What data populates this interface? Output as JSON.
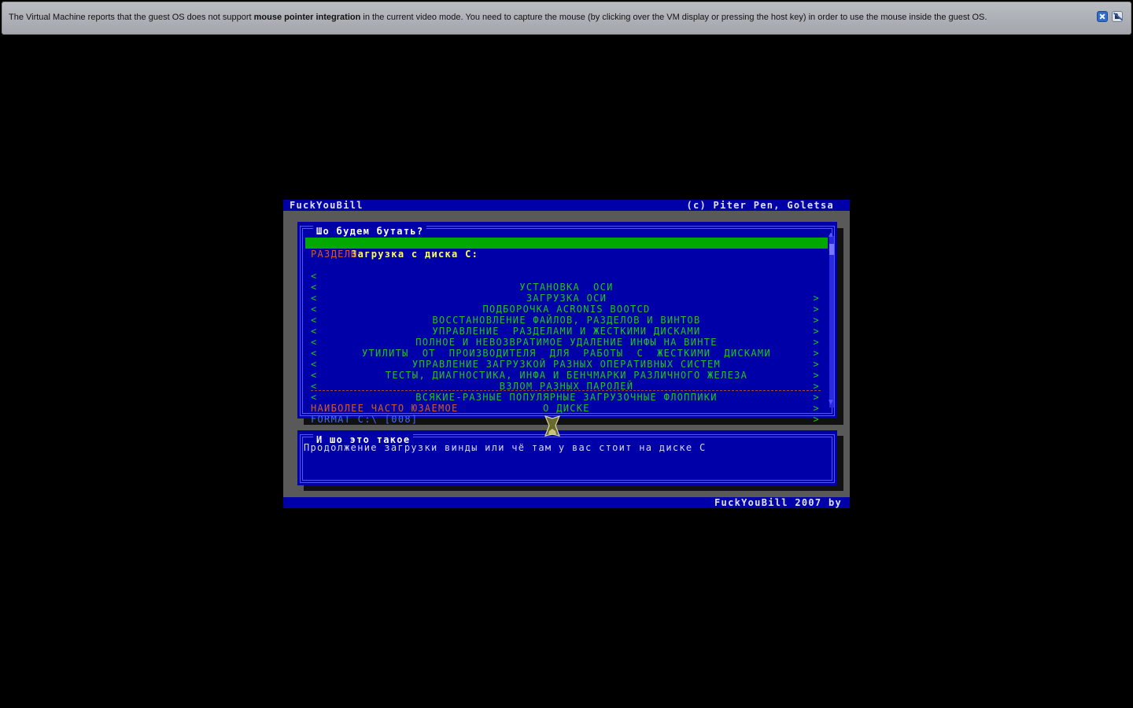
{
  "banner": {
    "text_before": "The Virtual Machine reports that the guest OS does not support ",
    "text_bold": "mouse pointer integration",
    "text_after": " in the current video mode. You need to capture the mouse (by clicking over the VM display or pressing the host key) in order to use the mouse inside the guest OS."
  },
  "header": {
    "left": "FuckYouBill",
    "right": "(c) Piter Pen, Goletsa"
  },
  "footer": {
    "text": "FuckYouBill 2007 by"
  },
  "menu": {
    "title": "Шо будем бутать?",
    "selected": "Загрузка с диска C:",
    "section_header": "РАЗДЕЛЫ",
    "left_bracket": "<",
    "right_bracket": ">",
    "items": [
      "УСТАНОВКА  ОСИ",
      "ЗАГРУЗКА ОСИ",
      "ПОДБОРОЧКА ACRONIS BOOTCD",
      "ВОССТАНОВЛЕНИЕ ФАЙЛОВ, РАЗДЕЛОВ И ВИНТОВ",
      "УПРАВЛЕНИЕ  РАЗДЕЛАМИ И ЖЕСТКИМИ ДИСКАМИ",
      "ПОЛНОЕ И НЕВОЗВРАТИМОЕ УДАЛЕНИЕ ИНФЫ НА ВИНТЕ",
      "УТИЛИТЫ  ОТ  ПРОИЗВОДИТЕЛЯ  ДЛЯ  РАБОТЫ  С  ЖЕСТКИМИ  ДИСКАМИ",
      "УПРАВЛЕНИЕ ЗАГРУЗКОЙ РАЗНЫХ ОПЕРАТИВНЫХ СИСТЕМ",
      "ТЕСТЫ, ДИАГНОСТИКА, ИНФА И БЕНЧМАРКИ РАЗЛИЧНОГО ЖЕЛЕЗА",
      "ВЗЛОМ РАЗНЫХ ПАРОЛЕЙ",
      "ВСЯКИЕ-РАЗНЫЕ ПОПУЛЯРНЫЕ ЗАГРУЗОЧНЫЕ ФЛОППИКИ",
      "О ДИСКЕ"
    ],
    "frequent_header": "НАИБОЛЕЕ ЧАСТО ЮЗАЕМОЕ",
    "format_item": "FORMAT C:\\ [008]"
  },
  "info": {
    "title": "И шо это такое",
    "text": "Продолжение загрузки винды или чё там у вас стоит на диске C"
  },
  "colors": {
    "screen_bg": "#000000",
    "panel_blue": "#0000a8",
    "gray_area": "#595959",
    "selection_green": "#00a800",
    "item_green": "#22c322",
    "header_orange": "#d45a2a"
  }
}
